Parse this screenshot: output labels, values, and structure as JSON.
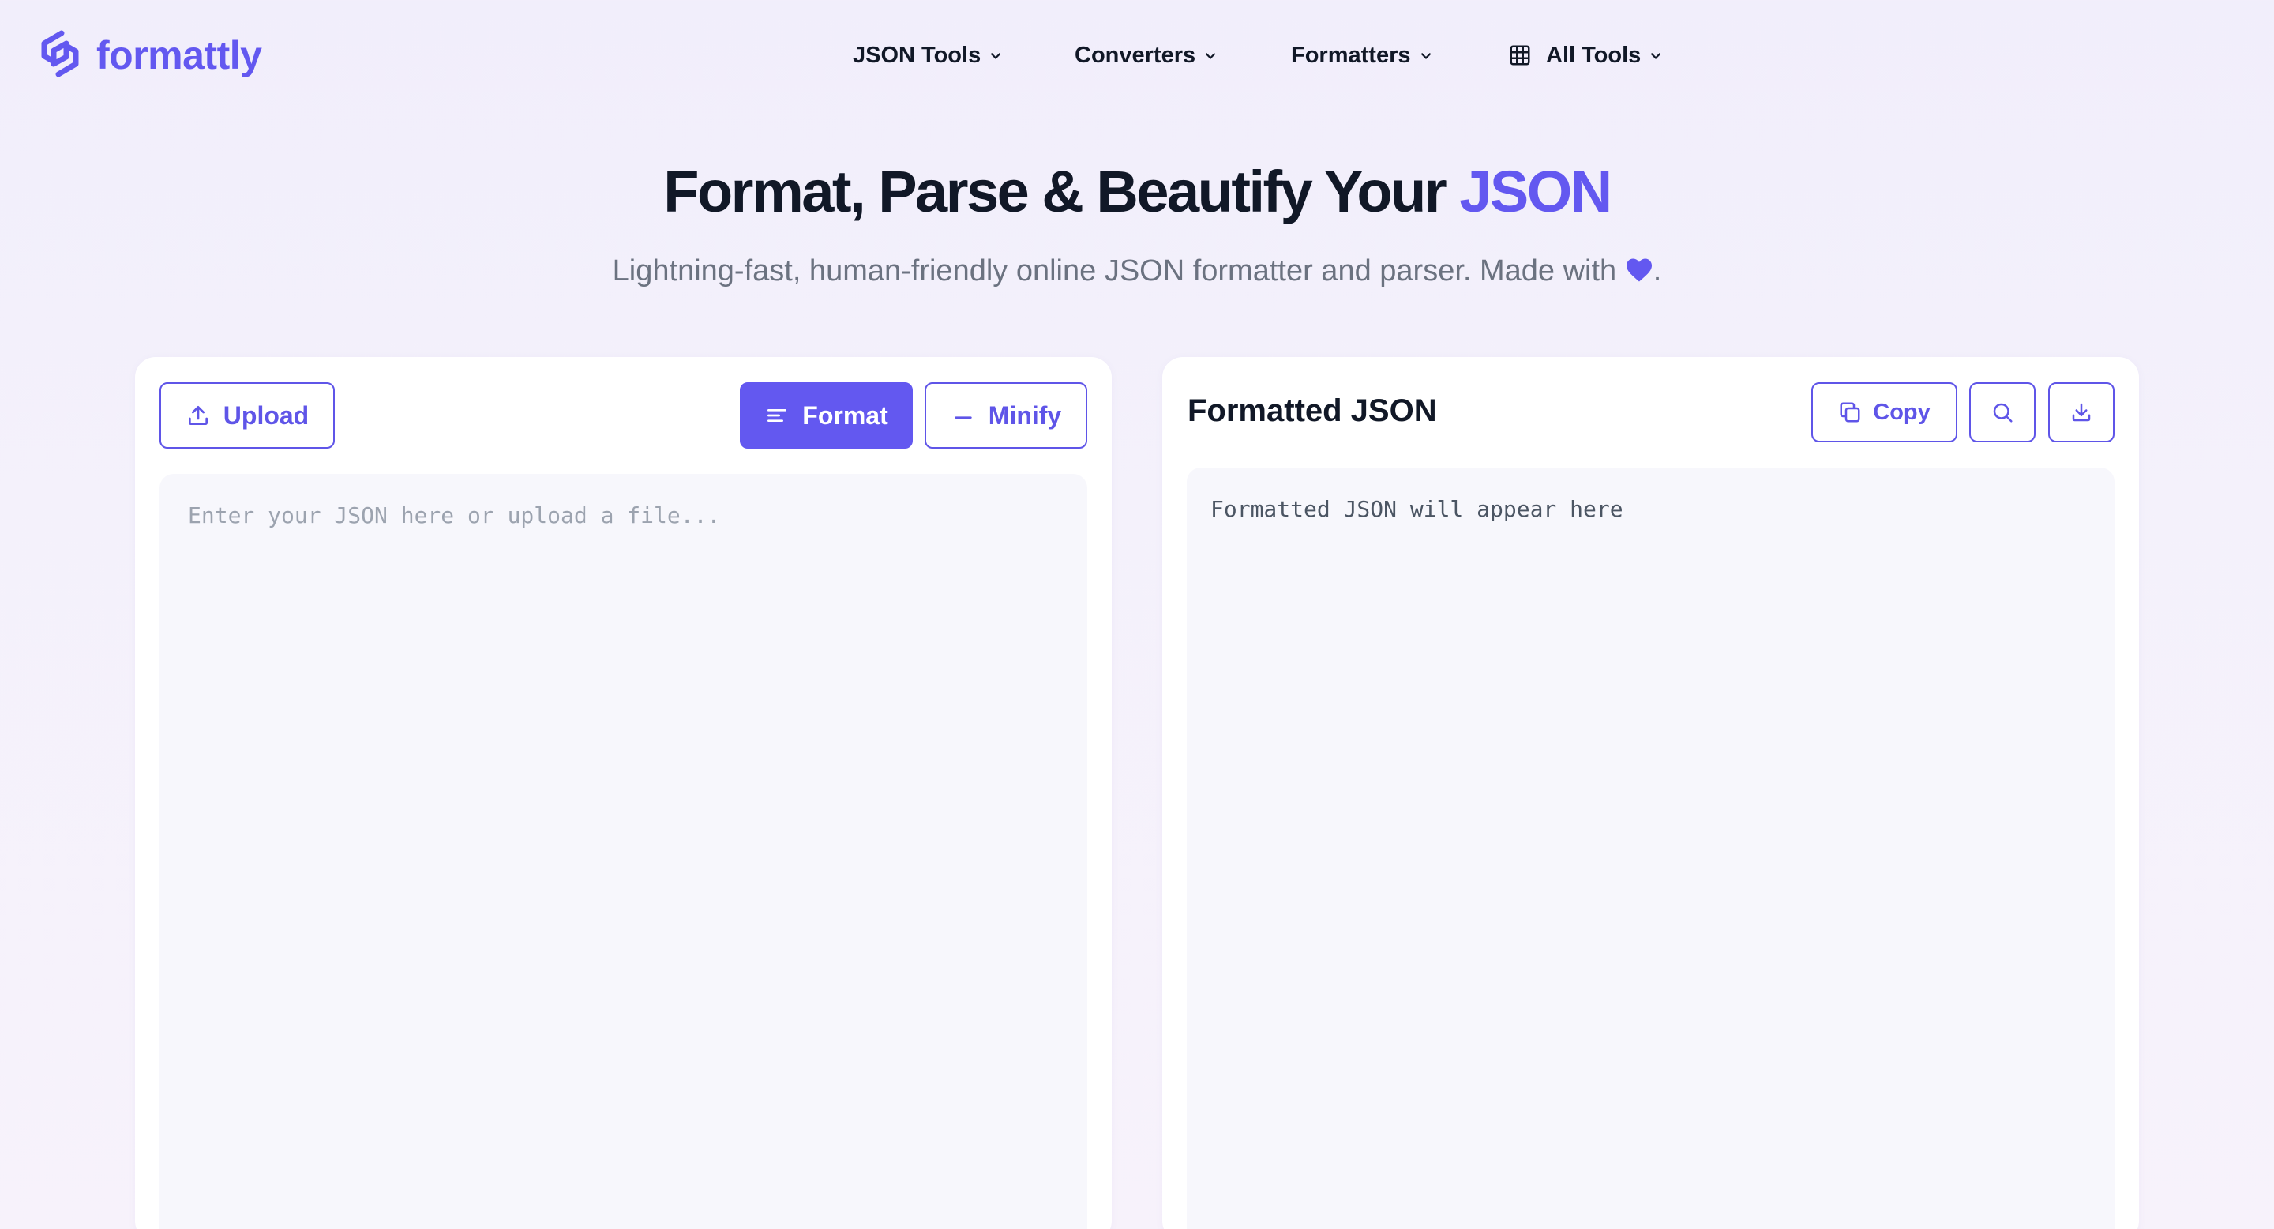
{
  "brand": {
    "name": "formattly",
    "color": "#6358f0"
  },
  "nav": {
    "items": [
      {
        "label": "JSON Tools"
      },
      {
        "label": "Converters"
      },
      {
        "label": "Formatters"
      },
      {
        "label": "All Tools"
      }
    ]
  },
  "hero": {
    "title_main": "Format, Parse & Beautify Your ",
    "title_accent": "JSON",
    "subtitle": "Lightning-fast, human-friendly online JSON formatter and parser. Made with ",
    "subtitle_end": "."
  },
  "input_panel": {
    "upload_label": "Upload",
    "format_label": "Format",
    "minify_label": "Minify",
    "placeholder": "Enter your JSON here or upload a file..."
  },
  "output_panel": {
    "title": "Formatted JSON",
    "copy_label": "Copy",
    "placeholder": "Formatted JSON will appear here"
  },
  "icons": {
    "logo": "formattly-logo-icon",
    "nav_chevron": "chevron-down-icon",
    "all_tools": "grid-icon",
    "upload": "upload-icon",
    "format": "align-left-icon",
    "minify": "minus-icon",
    "copy": "copy-icon",
    "search": "search-icon",
    "download": "download-icon",
    "heart": "heart-icon"
  }
}
